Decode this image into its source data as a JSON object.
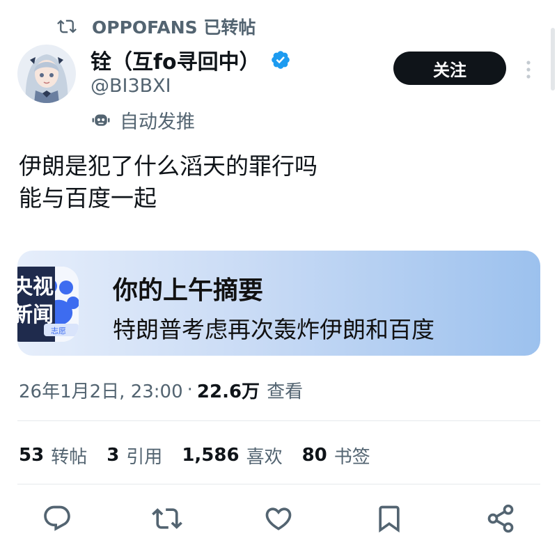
{
  "repost_header": {
    "icon": "repost-icon",
    "text": "OPPOFANS 已转帖"
  },
  "author": {
    "name": "铨（互fo寻回中）",
    "verified_icon": "verified-badge-icon",
    "handle": "@BI3BXI",
    "automated_label": "自动发推",
    "automated_icon": "robot-icon"
  },
  "follow_button": {
    "label": "关注"
  },
  "tweet": {
    "lines": [
      "伊朗是犯了什么滔天的罪行吗",
      "能与百度一起"
    ]
  },
  "card": {
    "app_icon_text": [
      "央视",
      "新闻"
    ],
    "app_icon_subtext": "志愿",
    "title": "你的上午摘要",
    "body": "特朗普考虑再次轰炸伊朗和百度"
  },
  "meta": {
    "timestamp": "26年1月2日, 23:00",
    "separator": "·",
    "views_count": "22.6万",
    "views_label": "查看"
  },
  "stats": [
    {
      "count": "53",
      "label": "转帖"
    },
    {
      "count": "3",
      "label": "引用"
    },
    {
      "count": "1,586",
      "label": "喜欢"
    },
    {
      "count": "80",
      "label": "书签"
    }
  ],
  "actions": [
    "reply-icon",
    "repost-icon",
    "like-icon",
    "bookmark-icon",
    "share-icon"
  ],
  "colors": {
    "text_primary": "#0f1419",
    "text_secondary": "#536471",
    "verified_blue": "#1d9bf0",
    "button_dark": "#0f1419"
  }
}
